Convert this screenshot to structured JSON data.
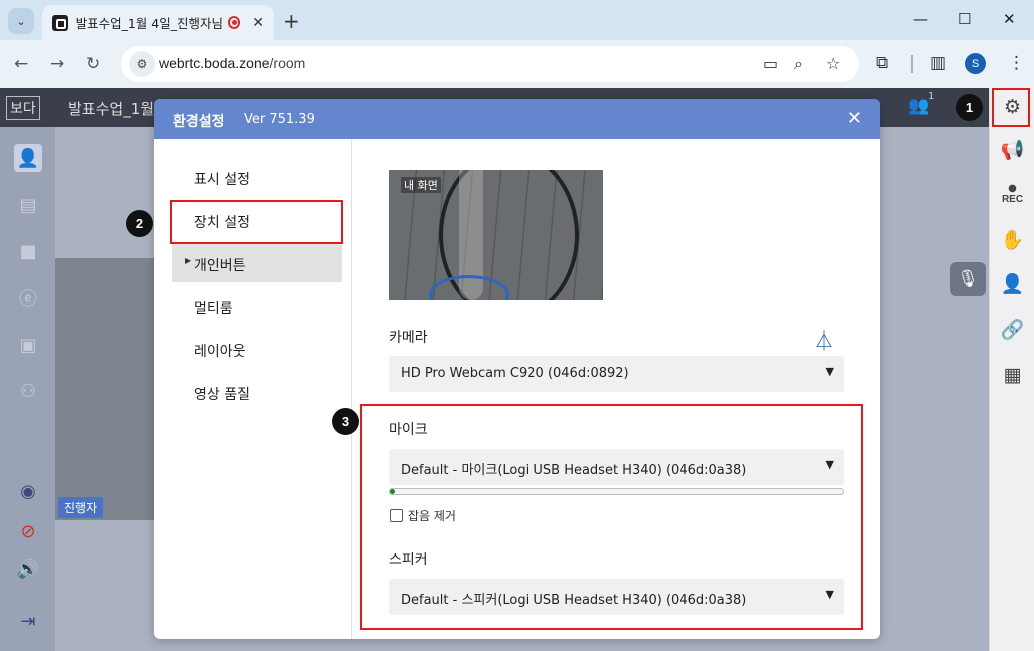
{
  "browser": {
    "tab_title": "발표수업_1월 4일_진행자님",
    "url_host": "webrtc.boda.zone",
    "url_path": "/room",
    "profile_initial": "S"
  },
  "app": {
    "logo": "보다",
    "title": "발표수업_1월",
    "participant_count": "1",
    "presenter_label": "진행자",
    "rec_label": "REC"
  },
  "dialog": {
    "title": "환경설정",
    "version": "Ver 751.39",
    "close_label": "✕",
    "menu": [
      {
        "label": "표시 설정"
      },
      {
        "label": "장치 설정"
      },
      {
        "label": "개인버튼"
      },
      {
        "label": "멀티룸"
      },
      {
        "label": "레이아웃"
      },
      {
        "label": "영상 품질"
      }
    ],
    "selected_menu": "장치 설정",
    "preview_label": "내 화면",
    "camera": {
      "label": "카메라",
      "value": "HD Pro Webcam C920 (046d:0892)"
    },
    "mic": {
      "label": "마이크",
      "value": "Default - 마이크(Logi USB Headset H340) (046d:0a38)",
      "level_percent": 1
    },
    "noise_reduction": {
      "label": "잡음 제거",
      "checked": false
    },
    "speaker": {
      "label": "스피커",
      "value": "Default - 스피커(Logi USB Headset H340) (046d:0a38)"
    }
  },
  "callouts": [
    "1",
    "2",
    "3"
  ],
  "colors": {
    "dialog_header": "#6486cf",
    "highlight": "#e31b1b",
    "level_fill": "#1a8a2a"
  }
}
